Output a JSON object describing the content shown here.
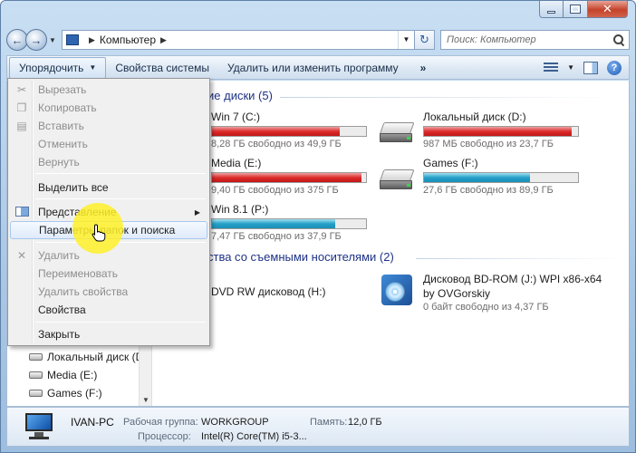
{
  "window": {
    "address": {
      "crumb": "Компьютер"
    },
    "search": {
      "placeholder": "Поиск: Компьютер"
    }
  },
  "toolbar": {
    "organize": "Упорядочить",
    "system_properties": "Свойства системы",
    "uninstall": "Удалить или изменить программу",
    "more": "»"
  },
  "menu": {
    "items": [
      {
        "label": "Вырезать",
        "enabled": false,
        "icon": "scissors-icon"
      },
      {
        "label": "Копировать",
        "enabled": false,
        "icon": "copy-icon"
      },
      {
        "label": "Вставить",
        "enabled": false,
        "icon": "paste-icon"
      },
      {
        "label": "Отменить",
        "enabled": false
      },
      {
        "label": "Вернуть",
        "enabled": false
      },
      {
        "label": "Выделить все",
        "enabled": true
      },
      {
        "label": "Представление",
        "enabled": true,
        "submenu": true,
        "icon": "layout-icon"
      },
      {
        "label": "Параметры папок и поиска",
        "enabled": true,
        "hover": true
      },
      {
        "label": "Удалить",
        "enabled": false,
        "icon": "delete-icon"
      },
      {
        "label": "Переименовать",
        "enabled": false
      },
      {
        "label": "Удалить свойства",
        "enabled": false
      },
      {
        "label": "Свойства",
        "enabled": true
      },
      {
        "label": "Закрыть",
        "enabled": true
      }
    ]
  },
  "hard_drives": {
    "header": "ие диски (5)",
    "drives": [
      {
        "name": "Win 7 (C:)",
        "free": "8,28 ГБ свободно из 49,9 ГБ",
        "used_fraction": 0.83,
        "color": "#dc2c2c"
      },
      {
        "name": "Локальный диск (D:)",
        "free": "987 МБ свободно из 23,7 ГБ",
        "used_fraction": 0.96,
        "color": "#dc2c2c"
      },
      {
        "name": "Media (E:)",
        "free": "9,40 ГБ свободно из 375 ГБ",
        "used_fraction": 0.97,
        "color": "#dc2c2c"
      },
      {
        "name": "Games (F:)",
        "free": "27,6 ГБ свободно из 89,9 ГБ",
        "used_fraction": 0.69,
        "color": "#26a0c8"
      },
      {
        "name": "Win 8.1 (P:)",
        "free": "7,47 ГБ свободно из 37,9 ГБ",
        "used_fraction": 0.8,
        "color": "#26a0c8"
      }
    ]
  },
  "removable": {
    "header": "ства со съемными носителями (2)",
    "dvd": {
      "name": "DVD RW дисковод (H:)"
    },
    "bd": {
      "name": "Дисковод BD-ROM (J:) WPI x86-x64",
      "name2": "by OVGorskiy",
      "free": "0 байт свободно из 4,37 ГБ"
    }
  },
  "navpane": {
    "items": [
      "Локальный диск (D",
      "Media (E:)",
      "Games (F:)"
    ]
  },
  "details": {
    "pc_name": "IVAN-PC",
    "workgroup_label": "Рабочая группа:",
    "workgroup_value": "WORKGROUP",
    "memory_label": "Память:",
    "memory_value": "12,0 ГБ",
    "cpu_label": "Процессор:",
    "cpu_value": "Intel(R) Core(TM) i5-3..."
  }
}
